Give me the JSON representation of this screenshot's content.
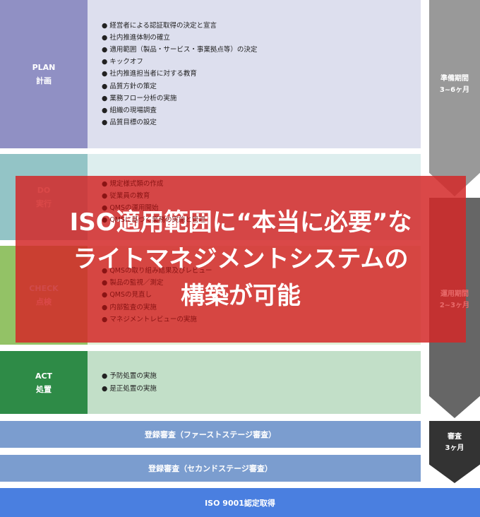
{
  "phases": [
    {
      "en": "PLAN",
      "ja": "計画",
      "label_color": "#9090c4",
      "bg": "#dddfee",
      "items": [
        "経営者による認証取得の決定と宣言",
        "社内推進体制の確立",
        "適用範囲（製品・サービス・事業拠点等）の決定",
        "キックオフ",
        "社内推進担当者に対する教育",
        "品質方針の策定",
        "業務フロー分析の実施",
        "組織の現場調査",
        "品質目標の設定"
      ]
    },
    {
      "en": "DO",
      "ja": "実行",
      "label_color": "#93c4c6",
      "bg": "#ddeeee",
      "items": [
        "規定様式類の作成",
        "従業員の教育",
        "QMSの運用開始",
        "QMSに基づく業務の実施と管理"
      ]
    },
    {
      "en": "CHECK",
      "ja": "点検",
      "label_color": "#93c266",
      "bg": "#e0eed5",
      "items": [
        "QMSの取り組み結果及びレビュー",
        "製品の監視／測定",
        "QMSの見直し",
        "内部監査の実施",
        "マネジメントレビューの実施"
      ]
    },
    {
      "en": "ACT",
      "ja": "処置",
      "label_color": "#2e8b47",
      "bg": "#c2dfc8",
      "items": [
        "予防処置の実施",
        "是正処置の実施"
      ]
    }
  ],
  "registration": [
    "登録審査（ファーストステージ審査）",
    "登録審査（セカンドステージ審査）"
  ],
  "final": "ISO 9001認定取得",
  "periods": [
    {
      "name": "準備期間",
      "duration": "3~6ヶ月",
      "color": "#999999"
    },
    {
      "name": "運用期間",
      "duration": "2~3ヶ月",
      "color": "#666666"
    },
    {
      "name": "審査",
      "duration": "3ヶ月",
      "color": "#333333"
    }
  ],
  "headline": [
    "ISO適用範囲に“本当に必要”な",
    "ライトマネジメントシステムの",
    "構築が可能"
  ]
}
